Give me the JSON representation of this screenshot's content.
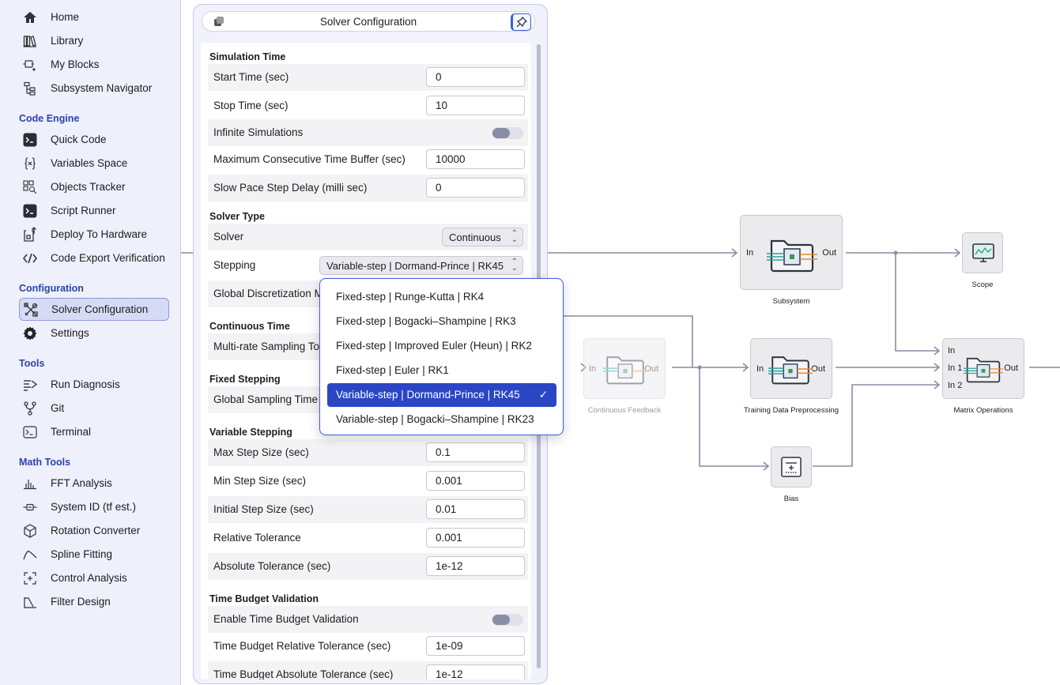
{
  "sidebar": {
    "nav": [
      {
        "label": "Home",
        "icon": "home-icon"
      },
      {
        "label": "Library",
        "icon": "library-icon"
      },
      {
        "label": "My Blocks",
        "icon": "my-blocks-icon"
      },
      {
        "label": "Subsystem Navigator",
        "icon": "subsystem-navigator-icon"
      }
    ],
    "sections": [
      {
        "title": "Code Engine",
        "items": [
          {
            "label": "Quick Code",
            "icon": "terminal-icon"
          },
          {
            "label": "Variables Space",
            "icon": "braces-icon"
          },
          {
            "label": "Objects Tracker",
            "icon": "objects-tracker-icon"
          },
          {
            "label": "Script Runner",
            "icon": "terminal-icon"
          },
          {
            "label": "Deploy To Hardware",
            "icon": "deploy-icon"
          },
          {
            "label": "Code Export Verification",
            "icon": "code-icon"
          }
        ]
      },
      {
        "title": "Configuration",
        "items": [
          {
            "label": "Solver Configuration",
            "icon": "tools-icon"
          },
          {
            "label": "Settings",
            "icon": "gear-icon"
          }
        ]
      },
      {
        "title": "Tools",
        "items": [
          {
            "label": "Run Diagnosis",
            "icon": "diagnosis-icon"
          },
          {
            "label": "Git",
            "icon": "git-branch-icon"
          },
          {
            "label": "Terminal",
            "icon": "terminal-outline-icon"
          }
        ]
      },
      {
        "title": "Math Tools",
        "items": [
          {
            "label": "FFT Analysis",
            "icon": "fft-icon"
          },
          {
            "label": "System ID (tf est.)",
            "icon": "system-id-icon"
          },
          {
            "label": "Rotation Converter",
            "icon": "cube-icon"
          },
          {
            "label": "Spline Fitting",
            "icon": "spline-icon"
          },
          {
            "label": "Control Analysis",
            "icon": "control-analysis-icon"
          },
          {
            "label": "Filter Design",
            "icon": "filter-icon"
          }
        ]
      }
    ]
  },
  "panel": {
    "title": "Solver Configuration",
    "simulation_time": {
      "heading": "Simulation Time",
      "start_time": {
        "label": "Start Time (sec)",
        "value": "0"
      },
      "stop_time": {
        "label": "Stop Time (sec)",
        "value": "10"
      },
      "infinite": {
        "label": "Infinite Simulations",
        "on": false
      },
      "max_buffer": {
        "label": "Maximum Consecutive Time Buffer (sec)",
        "value": "10000"
      },
      "slow_pace": {
        "label": "Slow Pace Step Delay (milli sec)",
        "value": "0"
      }
    },
    "solver_type": {
      "heading": "Solver Type",
      "solver": {
        "label": "Solver",
        "value": "Continuous"
      },
      "stepping": {
        "label": "Stepping",
        "value": "Variable-step | Dormand-Prince | RK45"
      },
      "global_disc": {
        "label": "Global Discretization M"
      }
    },
    "continuous_time": {
      "heading": "Continuous Time",
      "multi_rate": {
        "label": "Multi-rate Sampling To"
      }
    },
    "fixed_stepping": {
      "heading": "Fixed Stepping",
      "global_sampling": {
        "label": "Global Sampling Time ("
      }
    },
    "variable_stepping": {
      "heading": "Variable Stepping",
      "max_step": {
        "label": "Max Step Size (sec)",
        "value": "0.1"
      },
      "min_step": {
        "label": "Min Step Size (sec)",
        "value": "0.001"
      },
      "initial_step": {
        "label": "Initial Step Size (sec)",
        "value": "0.01"
      },
      "rel_tol": {
        "label": "Relative Tolerance",
        "value": "0.001"
      },
      "abs_tol": {
        "label": "Absolute Tolerance (sec)",
        "value": "1e-12"
      }
    },
    "time_budget": {
      "heading": "Time Budget Validation",
      "enable": {
        "label": "Enable Time Budget Validation",
        "on": false
      },
      "rel_tol": {
        "label": "Time Budget Relative Tolerance (sec)",
        "value": "1e-09"
      },
      "abs_tol": {
        "label": "Time Budget Absolute Tolerance (sec)",
        "value": "1e-12"
      }
    }
  },
  "dropdown": {
    "options": [
      {
        "label": "Fixed-step | Runge-Kutta | RK4",
        "selected": false
      },
      {
        "label": "Fixed-step | Bogacki–Shampine | RK3",
        "selected": false
      },
      {
        "label": "Fixed-step | Improved Euler (Heun) | RK2",
        "selected": false
      },
      {
        "label": "Fixed-step | Euler | RK1",
        "selected": false
      },
      {
        "label": "Variable-step | Dormand-Prince | RK45",
        "selected": true
      },
      {
        "label": "Variable-step | Bogacki–Shampine | RK23",
        "selected": false
      }
    ],
    "check": "✓"
  },
  "diagram": {
    "blocks": {
      "subsystem": {
        "label": "Subsystem",
        "in": "In",
        "out": "Out"
      },
      "scope": {
        "label": "Scope"
      },
      "continuous_feedback": {
        "label": "Continuous Feedback",
        "in": "In",
        "out": "Out"
      },
      "training": {
        "label": "Training Data Preprocessing",
        "in": "In",
        "out": "Out"
      },
      "matrix": {
        "label": "Matrix Operations",
        "in0": "In",
        "in1": "In 1",
        "in2": "In 2",
        "out": "Out"
      },
      "bias": {
        "label": "Bias"
      }
    },
    "colors": {
      "wire": "#8a8ca0",
      "accent": "#2b46c4",
      "orange": "#e5892f",
      "teal": "#2aa198",
      "green": "#3d9a44"
    }
  }
}
